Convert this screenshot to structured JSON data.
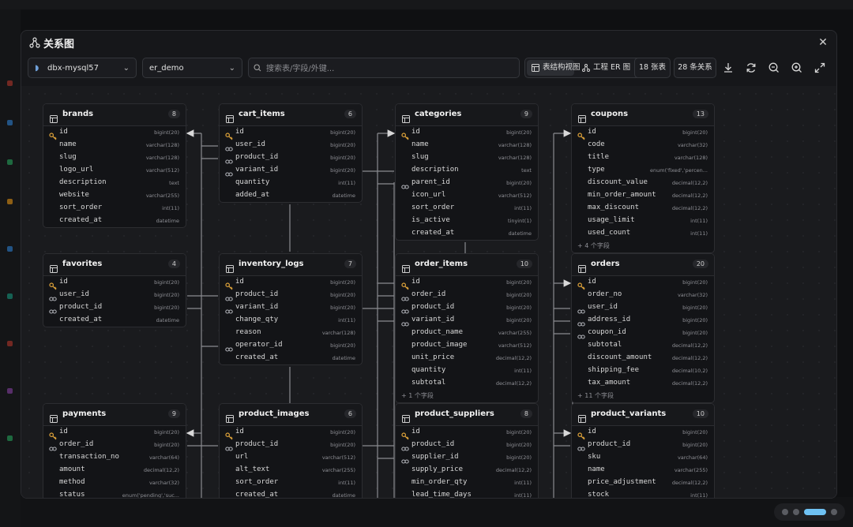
{
  "modal": {
    "title": "关系图",
    "close_icon": "close-icon"
  },
  "toolbar": {
    "connection": "dbx-mysql57",
    "database": "er_demo",
    "search_placeholder": "搜索表/字段/外键...",
    "view_table_structure": "表结构视图",
    "view_er": "工程 ER 图",
    "table_count": "18 张表",
    "relation_count": "28 条关系"
  },
  "tables": [
    {
      "name": "brands",
      "count": "8",
      "fields": [
        [
          "pk",
          "id",
          "bigint(20)"
        ],
        [
          "",
          "name",
          "varchar(128)"
        ],
        [
          "",
          "slug",
          "varchar(128)"
        ],
        [
          "",
          "logo_url",
          "varchar(512)"
        ],
        [
          "",
          "description",
          "text"
        ],
        [
          "",
          "website",
          "varchar(255)"
        ],
        [
          "",
          "sort_order",
          "int(11)"
        ],
        [
          "",
          "created_at",
          "datetime"
        ]
      ],
      "more": ""
    },
    {
      "name": "cart_items",
      "count": "6",
      "fields": [
        [
          "pk",
          "id",
          "bigint(20)"
        ],
        [
          "fk",
          "user_id",
          "bigint(20)"
        ],
        [
          "fk",
          "product_id",
          "bigint(20)"
        ],
        [
          "fk",
          "variant_id",
          "bigint(20)"
        ],
        [
          "",
          "quantity",
          "int(11)"
        ],
        [
          "",
          "added_at",
          "datetime"
        ]
      ],
      "more": ""
    },
    {
      "name": "categories",
      "count": "9",
      "fields": [
        [
          "pk",
          "id",
          "bigint(20)"
        ],
        [
          "",
          "name",
          "varchar(128)"
        ],
        [
          "",
          "slug",
          "varchar(128)"
        ],
        [
          "",
          "description",
          "text"
        ],
        [
          "fk",
          "parent_id",
          "bigint(20)"
        ],
        [
          "",
          "icon_url",
          "varchar(512)"
        ],
        [
          "",
          "sort_order",
          "int(11)"
        ],
        [
          "",
          "is_active",
          "tinyint(1)"
        ],
        [
          "",
          "created_at",
          "datetime"
        ]
      ],
      "more": ""
    },
    {
      "name": "coupons",
      "count": "13",
      "fields": [
        [
          "pk",
          "id",
          "bigint(20)"
        ],
        [
          "",
          "code",
          "varchar(32)"
        ],
        [
          "",
          "title",
          "varchar(128)"
        ],
        [
          "",
          "type",
          "enum('fixed','percen..."
        ],
        [
          "",
          "discount_value",
          "decimal(12,2)"
        ],
        [
          "",
          "min_order_amount",
          "decimal(12,2)"
        ],
        [
          "",
          "max_discount",
          "decimal(12,2)"
        ],
        [
          "",
          "usage_limit",
          "int(11)"
        ],
        [
          "",
          "used_count",
          "int(11)"
        ]
      ],
      "more": "+ 4 个字段"
    },
    {
      "name": "favorites",
      "count": "4",
      "fields": [
        [
          "pk",
          "id",
          "bigint(20)"
        ],
        [
          "fk",
          "user_id",
          "bigint(20)"
        ],
        [
          "fk",
          "product_id",
          "bigint(20)"
        ],
        [
          "",
          "created_at",
          "datetime"
        ]
      ],
      "more": ""
    },
    {
      "name": "inventory_logs",
      "count": "7",
      "fields": [
        [
          "pk",
          "id",
          "bigint(20)"
        ],
        [
          "fk",
          "product_id",
          "bigint(20)"
        ],
        [
          "fk",
          "variant_id",
          "bigint(20)"
        ],
        [
          "",
          "change_qty",
          "int(11)"
        ],
        [
          "",
          "reason",
          "varchar(128)"
        ],
        [
          "fk",
          "operator_id",
          "bigint(20)"
        ],
        [
          "",
          "created_at",
          "datetime"
        ]
      ],
      "more": ""
    },
    {
      "name": "order_items",
      "count": "10",
      "fields": [
        [
          "pk",
          "id",
          "bigint(20)"
        ],
        [
          "fk",
          "order_id",
          "bigint(20)"
        ],
        [
          "fk",
          "product_id",
          "bigint(20)"
        ],
        [
          "fk",
          "variant_id",
          "bigint(20)"
        ],
        [
          "",
          "product_name",
          "varchar(255)"
        ],
        [
          "",
          "product_image",
          "varchar(512)"
        ],
        [
          "",
          "unit_price",
          "decimal(12,2)"
        ],
        [
          "",
          "quantity",
          "int(11)"
        ],
        [
          "",
          "subtotal",
          "decimal(12,2)"
        ]
      ],
      "more": "+ 1 个字段"
    },
    {
      "name": "orders",
      "count": "20",
      "fields": [
        [
          "pk",
          "id",
          "bigint(20)"
        ],
        [
          "",
          "order_no",
          "varchar(32)"
        ],
        [
          "fk",
          "user_id",
          "bigint(20)"
        ],
        [
          "fk",
          "address_id",
          "bigint(20)"
        ],
        [
          "fk",
          "coupon_id",
          "bigint(20)"
        ],
        [
          "",
          "subtotal",
          "decimal(12,2)"
        ],
        [
          "",
          "discount_amount",
          "decimal(12,2)"
        ],
        [
          "",
          "shipping_fee",
          "decimal(10,2)"
        ],
        [
          "",
          "tax_amount",
          "decimal(12,2)"
        ]
      ],
      "more": "+ 11 个字段"
    },
    {
      "name": "payments",
      "count": "9",
      "fields": [
        [
          "pk",
          "id",
          "bigint(20)"
        ],
        [
          "fk",
          "order_id",
          "bigint(20)"
        ],
        [
          "",
          "transaction_no",
          "varchar(64)"
        ],
        [
          "",
          "amount",
          "decimal(12,2)"
        ],
        [
          "",
          "method",
          "varchar(32)"
        ],
        [
          "",
          "status",
          "enum('pending','suc..."
        ]
      ],
      "more": ""
    },
    {
      "name": "product_images",
      "count": "6",
      "fields": [
        [
          "pk",
          "id",
          "bigint(20)"
        ],
        [
          "fk",
          "product_id",
          "bigint(20)"
        ],
        [
          "",
          "url",
          "varchar(512)"
        ],
        [
          "",
          "alt_text",
          "varchar(255)"
        ],
        [
          "",
          "sort_order",
          "int(11)"
        ],
        [
          "",
          "created_at",
          "datetime"
        ]
      ],
      "more": ""
    },
    {
      "name": "product_suppliers",
      "count": "8",
      "fields": [
        [
          "pk",
          "id",
          "bigint(20)"
        ],
        [
          "fk",
          "product_id",
          "bigint(20)"
        ],
        [
          "fk",
          "supplier_id",
          "bigint(20)"
        ],
        [
          "",
          "supply_price",
          "decimal(12,2)"
        ],
        [
          "",
          "min_order_qty",
          "int(11)"
        ],
        [
          "",
          "lead_time_days",
          "int(11)"
        ]
      ],
      "more": ""
    },
    {
      "name": "product_variants",
      "count": "10",
      "fields": [
        [
          "pk",
          "id",
          "bigint(20)"
        ],
        [
          "fk",
          "product_id",
          "bigint(20)"
        ],
        [
          "",
          "sku",
          "varchar(64)"
        ],
        [
          "",
          "name",
          "varchar(255)"
        ],
        [
          "",
          "price_adjustment",
          "decimal(12,2)"
        ],
        [
          "",
          "stock",
          "int(11)"
        ]
      ],
      "more": ""
    }
  ]
}
